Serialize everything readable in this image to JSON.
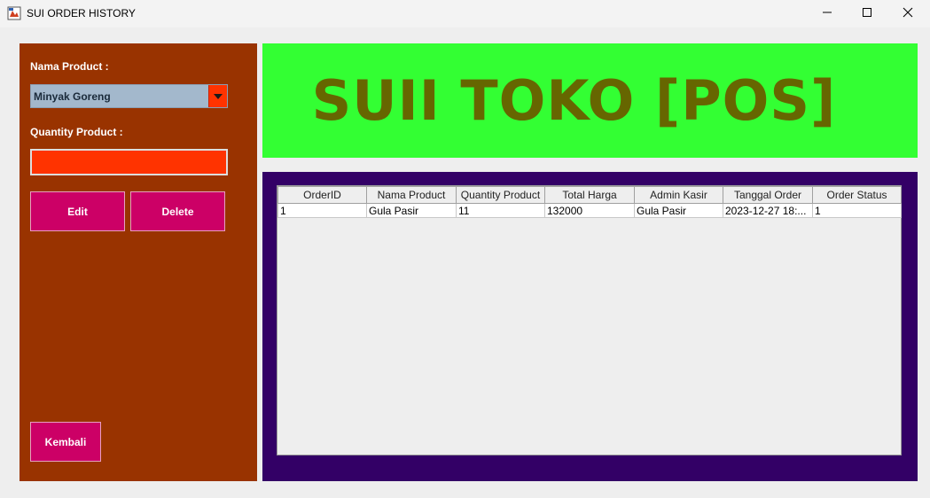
{
  "window": {
    "title": "SUI ORDER HISTORY",
    "icons": [
      "app-icon",
      "minimize-icon",
      "maximize-icon",
      "close-icon"
    ]
  },
  "form": {
    "nama_product_label": "Nama Product :",
    "nama_product_selected": "Minyak Goreng",
    "quantity_label": "Quantity Product :",
    "quantity_value": "",
    "edit_label": "Edit",
    "delete_label": "Delete",
    "kembali_label": "Kembali"
  },
  "header": {
    "title": "SUII TOKO [POS]"
  },
  "table": {
    "columns": [
      "OrderID",
      "Nama Product",
      "Quantity Product",
      "Total Harga",
      "Admin Kasir",
      "Tanggal Order",
      "Order Status"
    ],
    "rows": [
      [
        "1",
        "Gula Pasir",
        "11",
        "132000",
        "Gula Pasir",
        "2023-12-27 18:...",
        "1"
      ]
    ]
  },
  "colors": {
    "left_panel": "#993300",
    "header_panel": "#33ff33",
    "header_text": "#666600",
    "table_panel": "#330066",
    "button": "#cc0066",
    "input": "#ff3300",
    "combo": "#a3b8cc"
  }
}
